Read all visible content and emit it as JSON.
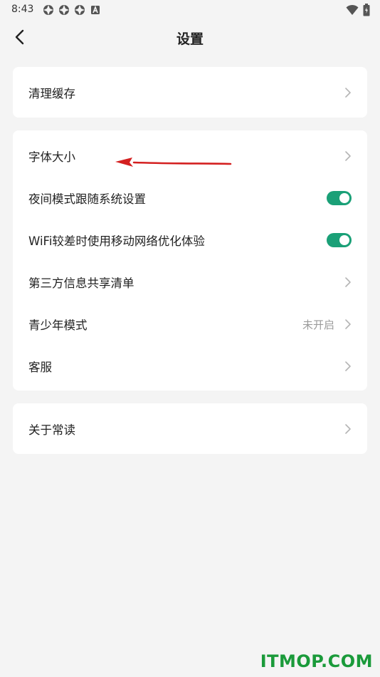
{
  "status_bar": {
    "time": "8:43",
    "icons": [
      "notification-icon",
      "notification-icon",
      "notification-icon",
      "a-icon"
    ],
    "right_icons": [
      "wifi-icon",
      "battery-icon"
    ]
  },
  "header": {
    "title": "设置",
    "back_icon": "chevron-left-icon"
  },
  "section1": {
    "items": [
      {
        "label": "清理缓存",
        "control": "chevron"
      }
    ]
  },
  "section2": {
    "items": [
      {
        "label": "字体大小",
        "control": "chevron"
      },
      {
        "label": "夜间模式跟随系统设置",
        "control": "toggle",
        "checked": true
      },
      {
        "label": "WiFi较差时使用移动网络优化体验",
        "control": "toggle",
        "checked": true
      },
      {
        "label": "第三方信息共享清单",
        "control": "chevron"
      },
      {
        "label": "青少年模式",
        "value": "未开启",
        "control": "chevron"
      },
      {
        "label": "客服",
        "control": "chevron"
      }
    ]
  },
  "section3": {
    "items": [
      {
        "label": "关于常读",
        "control": "chevron"
      }
    ]
  },
  "watermark": "ITMOP.COM",
  "colors": {
    "background": "#f4f4f4",
    "card": "#ffffff",
    "toggle_on": "#1aa077",
    "annotation_arrow": "#d42020",
    "watermark": "#1a9a3a"
  }
}
